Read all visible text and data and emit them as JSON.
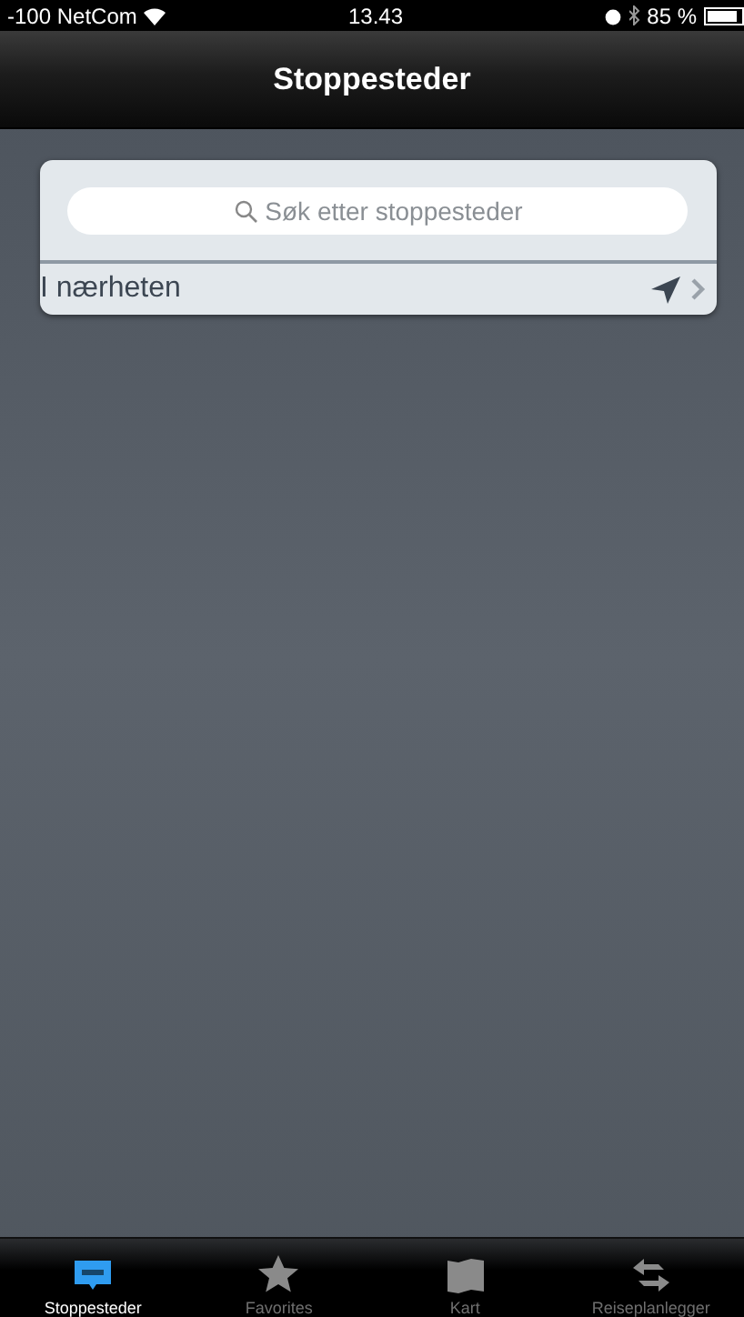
{
  "status_bar": {
    "carrier": "-100 NetCom",
    "time": "13.43",
    "battery": "85 %"
  },
  "nav_bar": {
    "title": "Stoppesteder"
  },
  "search": {
    "placeholder": "Søk etter stoppesteder"
  },
  "rows": [
    {
      "label": "I nærheten"
    }
  ],
  "tabs": [
    {
      "label": "Stoppesteder",
      "kind": "stops",
      "selected": true
    },
    {
      "label": "Favorites",
      "kind": "star",
      "selected": false
    },
    {
      "label": "Kart",
      "kind": "map",
      "selected": false
    },
    {
      "label": "Reiseplanlegger",
      "kind": "route",
      "selected": false
    }
  ]
}
